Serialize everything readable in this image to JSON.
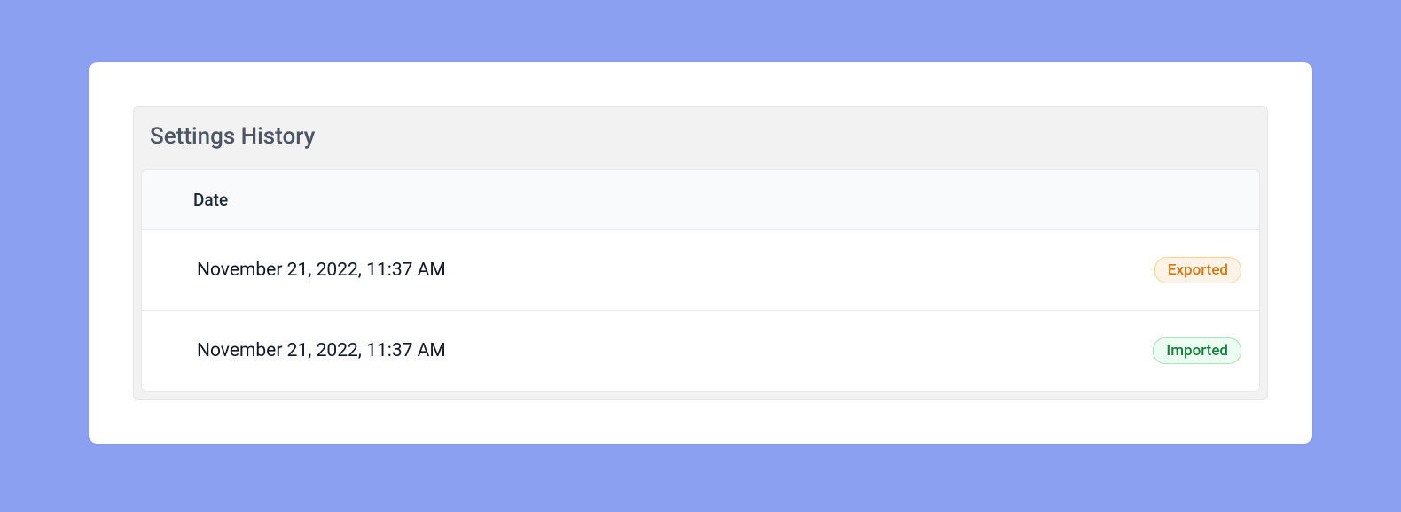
{
  "panel": {
    "title": "Settings History"
  },
  "table": {
    "header": "Date",
    "rows": [
      {
        "date": "November 21, 2022, 11:37 AM",
        "status": "Exported",
        "statusType": "exported"
      },
      {
        "date": "November 21, 2022, 11:37 AM",
        "status": "Imported",
        "statusType": "imported"
      }
    ]
  },
  "colors": {
    "background": "#8ca0f2",
    "card": "#ffffff",
    "panel": "#f2f2f2",
    "exportedBg": "#fef3e6",
    "exportedText": "#d97706",
    "importedBg": "#ecfdf1",
    "importedText": "#15803d"
  }
}
